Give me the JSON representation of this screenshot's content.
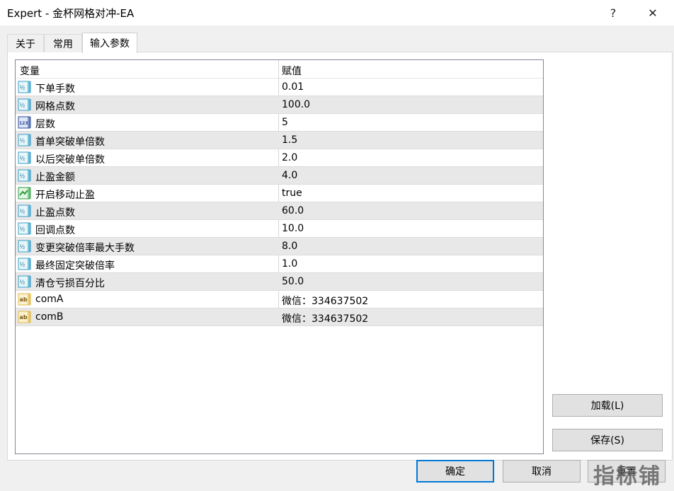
{
  "window": {
    "title": "Expert - 金杯网格对冲-EA",
    "help_label": "?",
    "close_label": "✕"
  },
  "tabs": [
    {
      "label": "关于"
    },
    {
      "label": "常用"
    },
    {
      "label": "输入参数",
      "active": true
    }
  ],
  "grid": {
    "columns": [
      "变量",
      "赋值"
    ],
    "rows": [
      {
        "icon": "double-value-icon",
        "name": "下单手数",
        "value": "0.01"
      },
      {
        "icon": "double-value-icon",
        "name": "网格点数",
        "value": "100.0"
      },
      {
        "icon": "integer-value-icon",
        "name": "层数",
        "value": "5"
      },
      {
        "icon": "double-value-icon",
        "name": "首单突破单倍数",
        "value": "1.5"
      },
      {
        "icon": "double-value-icon",
        "name": "以后突破单倍数",
        "value": "2.0"
      },
      {
        "icon": "double-value-icon",
        "name": "止盈金额",
        "value": "4.0"
      },
      {
        "icon": "boolean-value-icon",
        "name": "开启移动止盈",
        "value": "true"
      },
      {
        "icon": "double-value-icon",
        "name": "止盈点数",
        "value": "60.0"
      },
      {
        "icon": "double-value-icon",
        "name": "回调点数",
        "value": "10.0"
      },
      {
        "icon": "double-value-icon",
        "name": "变更突破倍率最大手数",
        "value": "8.0"
      },
      {
        "icon": "double-value-icon",
        "name": "最终固定突破倍率",
        "value": "1.0"
      },
      {
        "icon": "double-value-icon",
        "name": "清仓亏损百分比",
        "value": "50.0"
      },
      {
        "icon": "string-value-icon",
        "name": "comA",
        "value": "微信：334637502"
      },
      {
        "icon": "string-value-icon",
        "name": "comB",
        "value": "微信：334637502"
      }
    ]
  },
  "buttons": {
    "load": "加载(L)",
    "save": "保存(S)",
    "ok": "确定",
    "cancel": "取消",
    "reset": "重置"
  },
  "watermark": "指标铺",
  "colors": {
    "alt_row": "#e8e8e8",
    "ok_border": "#0078d7",
    "double_icon": "#3aa0c8",
    "integer_icon": "#2a4a9a",
    "boolean_icon": "#2e9e3e",
    "string_icon": "#e0b84a"
  }
}
